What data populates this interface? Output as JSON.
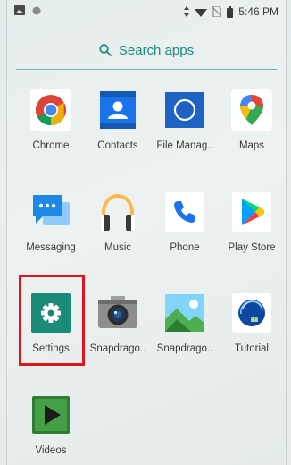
{
  "status_bar": {
    "time": "5:46 PM"
  },
  "search": {
    "placeholder": "Search apps"
  },
  "apps": [
    {
      "label": "Chrome"
    },
    {
      "label": "Contacts"
    },
    {
      "label": "File Manag.."
    },
    {
      "label": "Maps"
    },
    {
      "label": "Messaging"
    },
    {
      "label": "Music"
    },
    {
      "label": "Phone"
    },
    {
      "label": "Play Store"
    },
    {
      "label": "Settings"
    },
    {
      "label": "Snapdrago.."
    },
    {
      "label": "Snapdrago.."
    },
    {
      "label": "Tutorial"
    },
    {
      "label": "Videos"
    }
  ],
  "colors": {
    "accent": "#1b8a83",
    "highlight": "#e0141b"
  }
}
